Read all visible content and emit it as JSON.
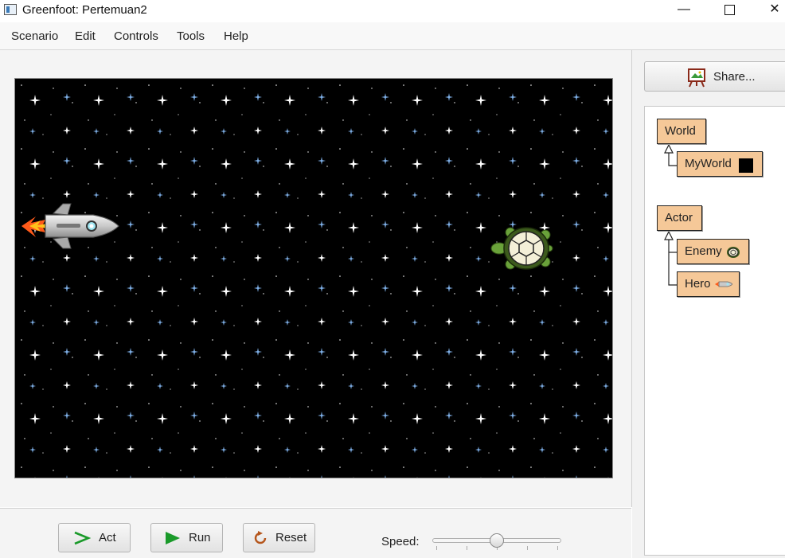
{
  "window": {
    "title": "Greenfoot: Pertemuan2",
    "minimize_glyph": "—",
    "close_glyph": "✕"
  },
  "menu": {
    "items": [
      "Scenario",
      "Edit",
      "Controls",
      "Tools",
      "Help"
    ]
  },
  "share": {
    "label": "Share..."
  },
  "classes": {
    "world": {
      "label": "World"
    },
    "myworld": {
      "label": "MyWorld"
    },
    "actor": {
      "label": "Actor"
    },
    "enemy": {
      "label": "Enemy"
    },
    "hero": {
      "label": "Hero"
    }
  },
  "controls": {
    "act_label": "Act",
    "run_label": "Run",
    "reset_label": "Reset",
    "speed_label": "Speed:",
    "speed_value": 0.5
  },
  "colors": {
    "class_box": "#f5c898",
    "world_background": "#000000",
    "run_green": "#1a9a2a",
    "reset_orange": "#b5561c"
  },
  "icons": {
    "app": "greenfoot-icon",
    "share": "easel-icon",
    "act": "step-arrow-icon",
    "run": "play-icon",
    "reset": "reset-icon"
  }
}
